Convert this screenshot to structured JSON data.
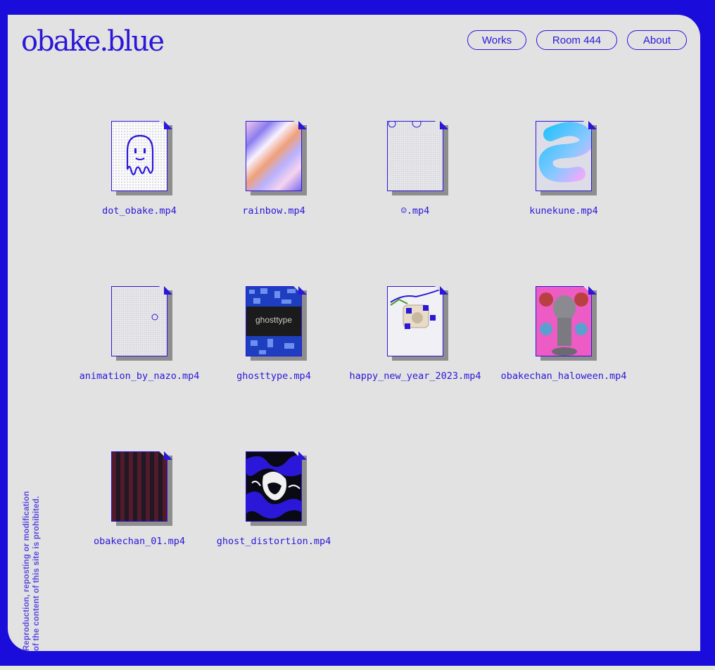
{
  "site": {
    "logo": "obake.blue"
  },
  "nav": {
    "works": "Works",
    "room": "Room 444",
    "about": "About"
  },
  "files": [
    {
      "name": "dot_obake.mp4"
    },
    {
      "name": "rainbow.mp4"
    },
    {
      "name": "☺.mp4"
    },
    {
      "name": "kunekune.mp4"
    },
    {
      "name": "animation_by_nazo.mp4"
    },
    {
      "name": "ghosttype.mp4",
      "thumb_text": "ghosttype"
    },
    {
      "name": "happy_new_year_2023.mp4"
    },
    {
      "name": "obakechan_haloween.mp4"
    },
    {
      "name": "obakechan_01.mp4"
    },
    {
      "name": "ghost_distortion.mp4"
    }
  ],
  "footer": {
    "line1": "Reproduction, reposting or modification",
    "line2": "of the content of this site is prohibited."
  },
  "colors": {
    "frame": "#1a0ddb",
    "panel": "#e2e2e3",
    "accent": "#2a17d8",
    "shadow": "#8e8e8e"
  }
}
